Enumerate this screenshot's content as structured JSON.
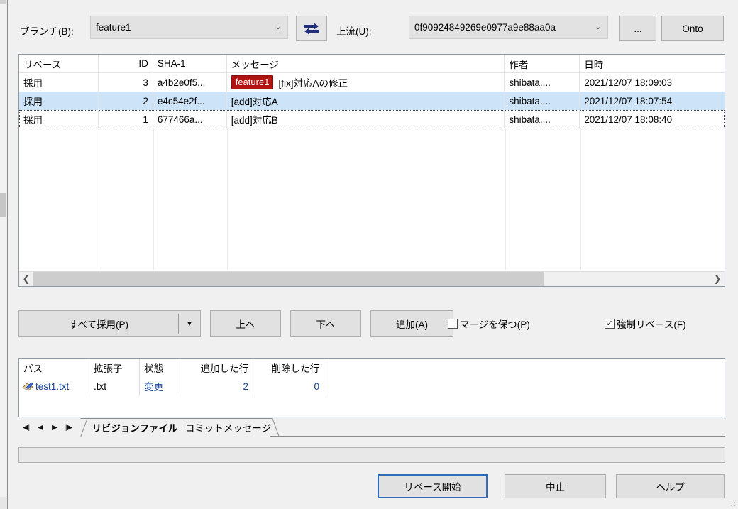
{
  "toolbar": {
    "branch_label": "ブランチ(B):",
    "branch_value": "feature1",
    "swap_icon": "swap-arrows-icon",
    "upstream_label": "上流(U):",
    "upstream_value": "0f90924849269e0977a9e88aa0a",
    "browse_label": "...",
    "onto_label": "Onto",
    "dropdown_arrow": "⌄"
  },
  "revisions": {
    "columns": [
      "リベース",
      "ID",
      "SHA-1",
      "メッセージ",
      "作者",
      "日時"
    ],
    "rows": [
      {
        "action": "採用",
        "id": "3",
        "sha": "a4b2e0f5...",
        "ref": "feature1",
        "message": "[fix]対応Aの修正",
        "author": "shibata....",
        "date": "2021/12/07 18:09:03"
      },
      {
        "action": "採用",
        "id": "2",
        "sha": "e4c54e2f...",
        "ref": "",
        "message": "[add]対応A",
        "author": "shibata....",
        "date": "2021/12/07 18:07:54"
      },
      {
        "action": "採用",
        "id": "1",
        "sha": "677466a...",
        "ref": "",
        "message": "[add]対応B",
        "author": "shibata....",
        "date": "2021/12/07 18:08:40"
      }
    ],
    "scroll_left_icon": "❮",
    "scroll_right_icon": "❯"
  },
  "actions": {
    "pick_all_label": "すべて採用(P)",
    "pick_all_arrow": "▼",
    "up_label": "上へ",
    "down_label": "下へ",
    "add_label": "追加(A)",
    "keep_merges_label": "マージを保つ(P)",
    "keep_merges_checked": false,
    "force_rebase_label": "強制リベース(F)",
    "force_rebase_checked": true,
    "check_glyph": "✓"
  },
  "files": {
    "columns": [
      "パス",
      "拡張子",
      "状態",
      "追加した行",
      "削除した行"
    ],
    "rows": [
      {
        "icon": "modified-file-icon",
        "path": "test1.txt",
        "ext": ".txt",
        "status": "変更",
        "added": "2",
        "deleted": "0"
      }
    ]
  },
  "tabbar": {
    "nav_first_icon": "◀|",
    "nav_prev_icon": "◀",
    "nav_next_icon": "▶",
    "nav_last_icon": "|▶",
    "tabs": [
      {
        "label": "リビジョンファイル",
        "active": true
      },
      {
        "label": "コミットメッセージ",
        "active": false
      }
    ]
  },
  "statusbar": {
    "text": ""
  },
  "footer": {
    "start_label": "リベース開始",
    "abort_label": "中止",
    "help_label": "ヘルプ"
  }
}
